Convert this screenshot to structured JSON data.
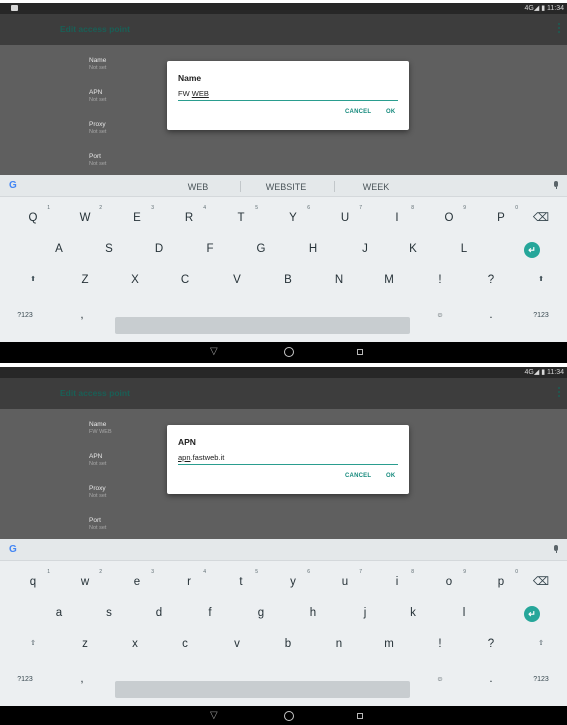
{
  "status_bar": {
    "right_text": "4G◢ ▮ 11:34"
  },
  "app_bar": {
    "title": "Edit access point"
  },
  "screens": [
    {
      "prefs": [
        {
          "title": "Name",
          "summary": "Not set"
        },
        {
          "title": "APN",
          "summary": "Not set"
        },
        {
          "title": "Proxy",
          "summary": "Not set"
        },
        {
          "title": "Port",
          "summary": "Not set"
        }
      ],
      "dialog": {
        "title": "Name",
        "value_plain": "FW ",
        "value_underlined": "WEB",
        "cancel": "CANCEL",
        "ok": "OK"
      },
      "suggestions": [
        "WEB",
        "WEBSITE",
        "WEEK"
      ],
      "keyboard": {
        "row1": [
          "Q",
          "W",
          "E",
          "R",
          "T",
          "Y",
          "U",
          "I",
          "O",
          "P"
        ],
        "row1_hints": [
          "1",
          "2",
          "3",
          "4",
          "5",
          "6",
          "7",
          "8",
          "9",
          "0"
        ],
        "row2": [
          "A",
          "S",
          "D",
          "F",
          "G",
          "H",
          "J",
          "K",
          "L"
        ],
        "row3": [
          "⬆",
          "Z",
          "X",
          "C",
          "V",
          "B",
          "N",
          "M",
          "!",
          "?",
          "⬆"
        ],
        "row4": {
          "symbols": "?123",
          "comma": ",",
          "emoji": "☺",
          "period": ".",
          "symbols_right": "?123"
        },
        "backspace": "⌫",
        "enter": "↵"
      }
    },
    {
      "prefs": [
        {
          "title": "Name",
          "summary": "FW WEB"
        },
        {
          "title": "APN",
          "summary": "Not set"
        },
        {
          "title": "Proxy",
          "summary": "Not set"
        },
        {
          "title": "Port",
          "summary": "Not set"
        }
      ],
      "dialog": {
        "title": "APN",
        "value_plain": ".fastweb.it",
        "value_underlined": "apn",
        "cancel": "CANCEL",
        "ok": "OK"
      },
      "suggestions": [],
      "keyboard": {
        "row1": [
          "q",
          "w",
          "e",
          "r",
          "t",
          "y",
          "u",
          "i",
          "o",
          "p"
        ],
        "row1_hints": [
          "1",
          "2",
          "3",
          "4",
          "5",
          "6",
          "7",
          "8",
          "9",
          "0"
        ],
        "row2": [
          "a",
          "s",
          "d",
          "f",
          "g",
          "h",
          "j",
          "k",
          "l"
        ],
        "row3": [
          "⇧",
          "z",
          "x",
          "c",
          "v",
          "b",
          "n",
          "m",
          "!",
          "?",
          "⇧"
        ],
        "row4": {
          "symbols": "?123",
          "comma": ",",
          "emoji": "☺",
          "period": ".",
          "symbols_right": "?123"
        },
        "backspace": "⌫",
        "enter": "↵"
      }
    }
  ],
  "nav": {
    "back": "▽"
  }
}
